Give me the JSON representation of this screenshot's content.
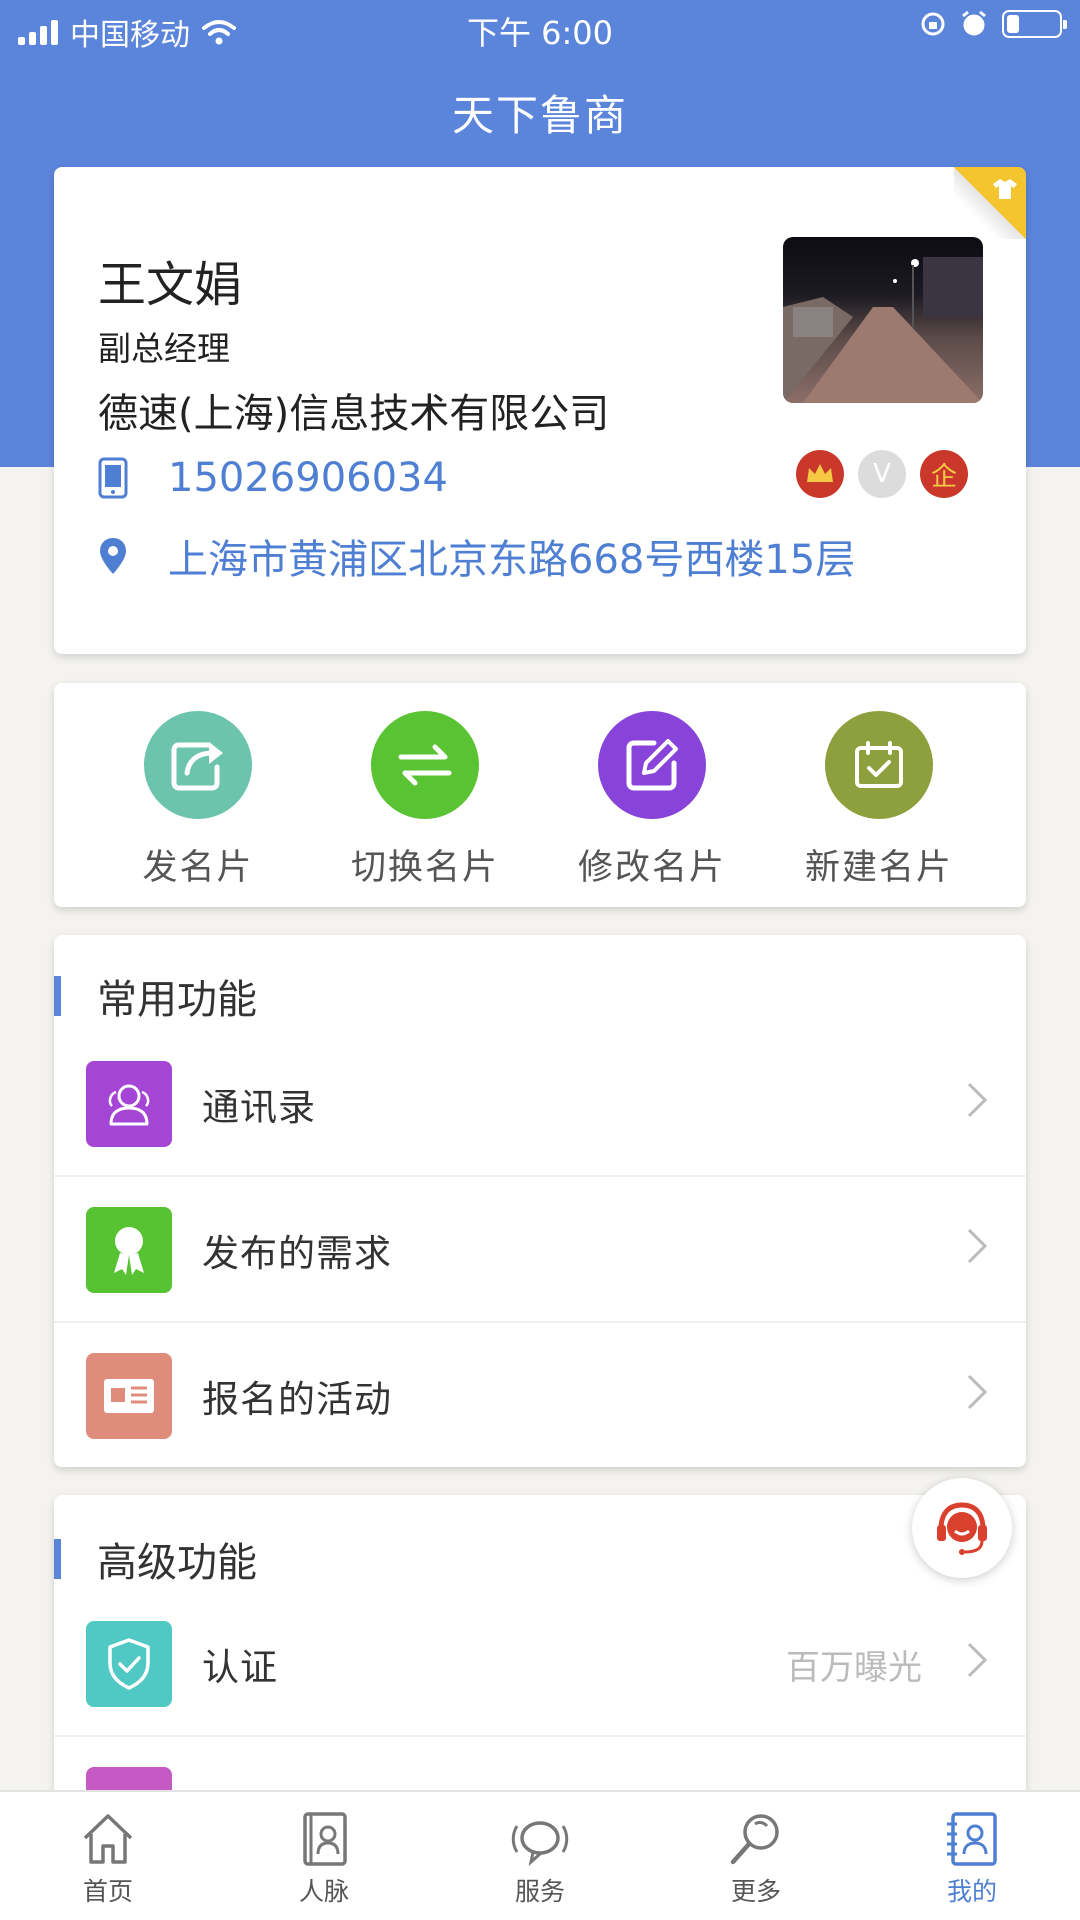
{
  "status_bar": {
    "carrier": "中国移动",
    "time": "下午 6:00"
  },
  "header": {
    "title": "天下鲁商"
  },
  "profile": {
    "name": "王文娟",
    "position": "副总经理",
    "company": "德速(上海)信息技术有限公司",
    "phone": "15026906034",
    "address": "上海市黄浦区北京东路668号西楼15层",
    "badges": [
      {
        "icon": "crown-icon",
        "color": "#c9382b"
      },
      {
        "text": "V",
        "color": "#dcdcdc"
      },
      {
        "text": "企",
        "color": "#c9382b"
      }
    ]
  },
  "actions": [
    {
      "label": "发名片",
      "color": "#6cc4ad",
      "icon": "share-icon"
    },
    {
      "label": "切换名片",
      "color": "#5ac333",
      "icon": "switch-arrows-icon"
    },
    {
      "label": "修改名片",
      "color": "#8843db",
      "icon": "edit-icon"
    },
    {
      "label": "新建名片",
      "color": "#8ea03d",
      "icon": "calendar-check-icon"
    }
  ],
  "common": {
    "title": "常用功能",
    "items": [
      {
        "label": "通讯录",
        "color": "#a545d6",
        "icon": "contacts-icon"
      },
      {
        "label": "发布的需求",
        "color": "#58c332",
        "icon": "ribbon-icon"
      },
      {
        "label": "报名的活动",
        "color": "#e08c7c",
        "icon": "id-card-icon"
      }
    ]
  },
  "advanced": {
    "title": "高级功能",
    "items": [
      {
        "label": "认证",
        "extra": "百万曝光",
        "color": "#50c8c3",
        "icon": "shield-check-icon"
      },
      {
        "label": "",
        "color": "#c55ac4",
        "icon": "app-icon"
      }
    ]
  },
  "tabbar": {
    "items": [
      {
        "label": "首页",
        "icon": "home-icon",
        "active": false
      },
      {
        "label": "人脉",
        "icon": "contacts-book-icon",
        "active": false
      },
      {
        "label": "服务",
        "icon": "speech-bubble-icon",
        "active": false
      },
      {
        "label": "更多",
        "icon": "search-icon",
        "active": false
      },
      {
        "label": "我的",
        "icon": "profile-card-icon",
        "active": true
      }
    ],
    "active_color": "#4f7fd2"
  }
}
